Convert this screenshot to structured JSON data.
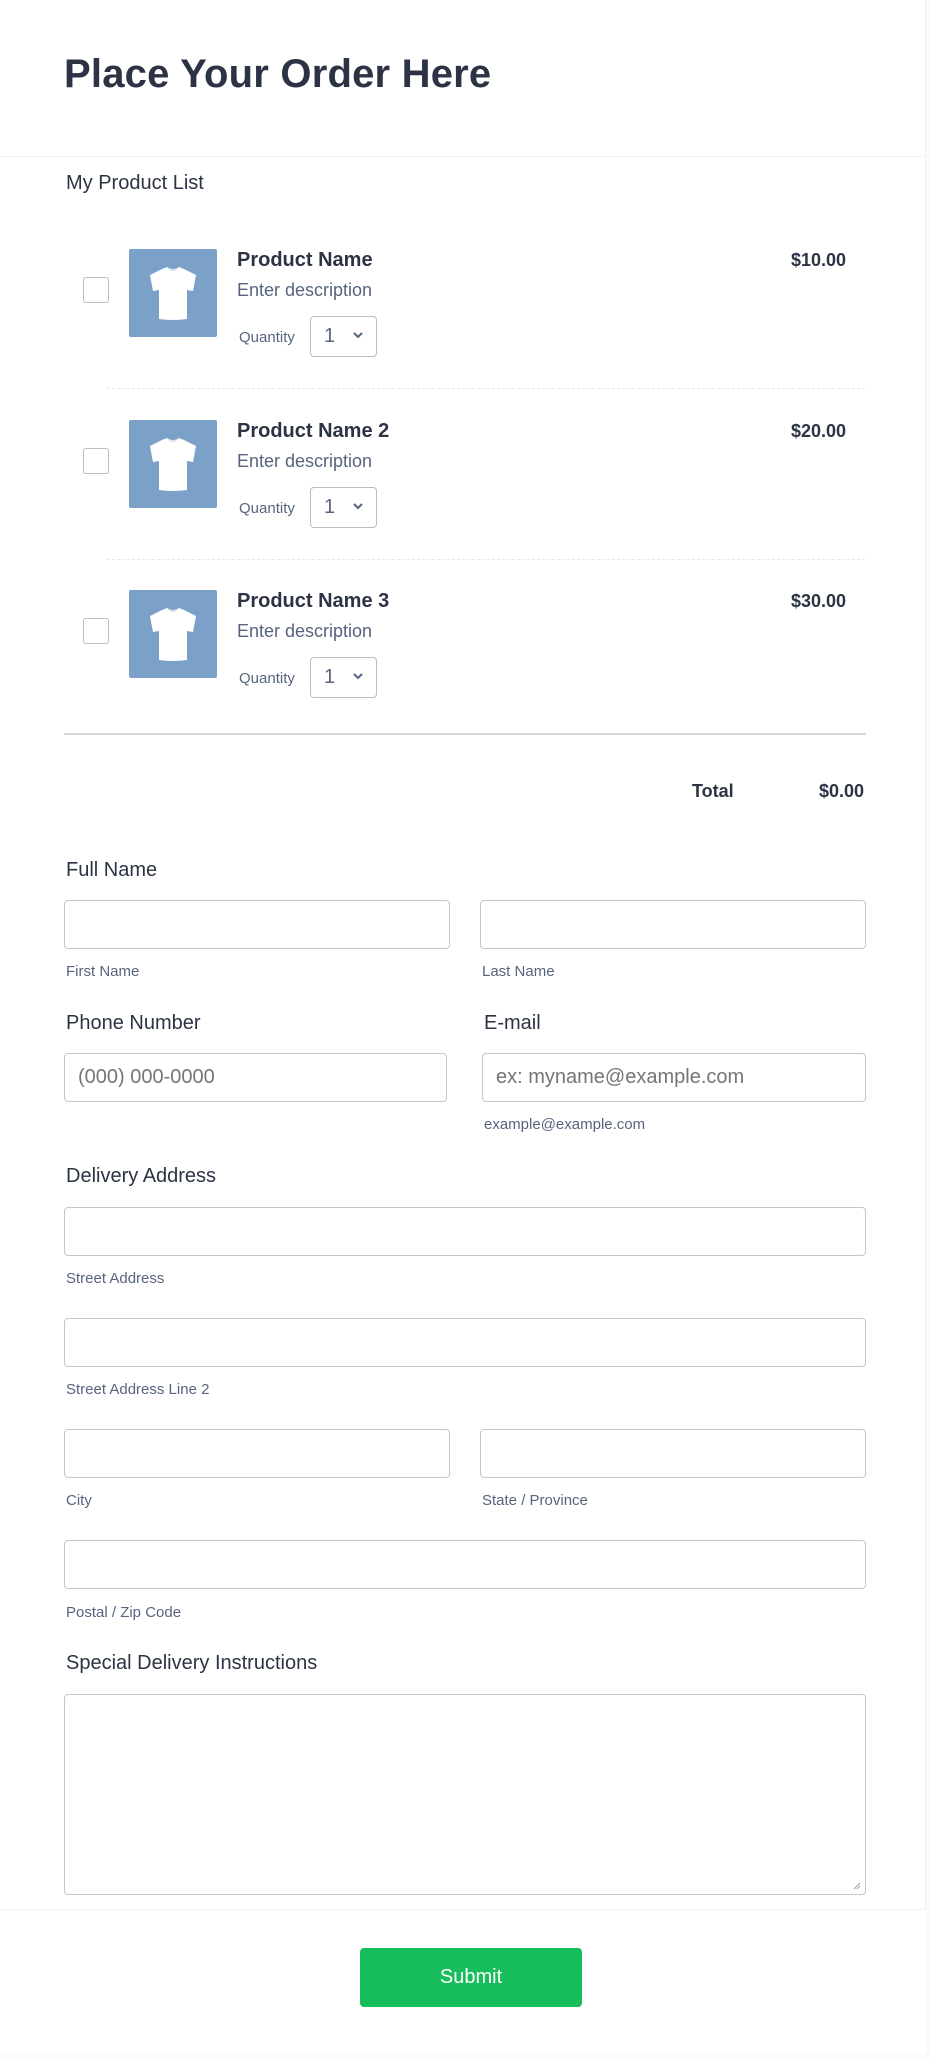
{
  "header": {
    "title": "Place Your Order Here"
  },
  "products": {
    "section_label": "My Product List",
    "quantity_label": "Quantity",
    "items": [
      {
        "name": "Product Name",
        "description": "Enter description",
        "quantity": "1",
        "price": "$10.00",
        "checked": false,
        "image": "tshirt-icon"
      },
      {
        "name": "Product Name 2",
        "description": "Enter description",
        "quantity": "1",
        "price": "$20.00",
        "checked": false,
        "image": "tshirt-icon"
      },
      {
        "name": "Product Name 3",
        "description": "Enter description",
        "quantity": "1",
        "price": "$30.00",
        "checked": false,
        "image": "tshirt-icon"
      }
    ],
    "total_label": "Total",
    "total_value": "$0.00"
  },
  "full_name": {
    "label": "Full Name",
    "first_name": {
      "value": "",
      "sublabel": "First Name"
    },
    "last_name": {
      "value": "",
      "sublabel": "Last Name"
    }
  },
  "phone": {
    "label": "Phone Number",
    "value": "",
    "placeholder": "(000) 000-0000"
  },
  "email": {
    "label": "E-mail",
    "value": "",
    "placeholder": "ex: myname@example.com",
    "sublabel": "example@example.com"
  },
  "address": {
    "label": "Delivery Address",
    "street": {
      "value": "",
      "sublabel": "Street Address"
    },
    "street2": {
      "value": "",
      "sublabel": "Street Address Line 2"
    },
    "city": {
      "value": "",
      "sublabel": "City"
    },
    "state": {
      "value": "",
      "sublabel": "State / Province"
    },
    "postal": {
      "value": "",
      "sublabel": "Postal / Zip Code"
    }
  },
  "instructions": {
    "label": "Special Delivery Instructions",
    "value": ""
  },
  "submit": {
    "label": "Submit"
  },
  "colors": {
    "accent": "#18bd5b",
    "text": "#2c3345",
    "muted": "#57647e",
    "thumb_bg": "#7ba1c9"
  }
}
